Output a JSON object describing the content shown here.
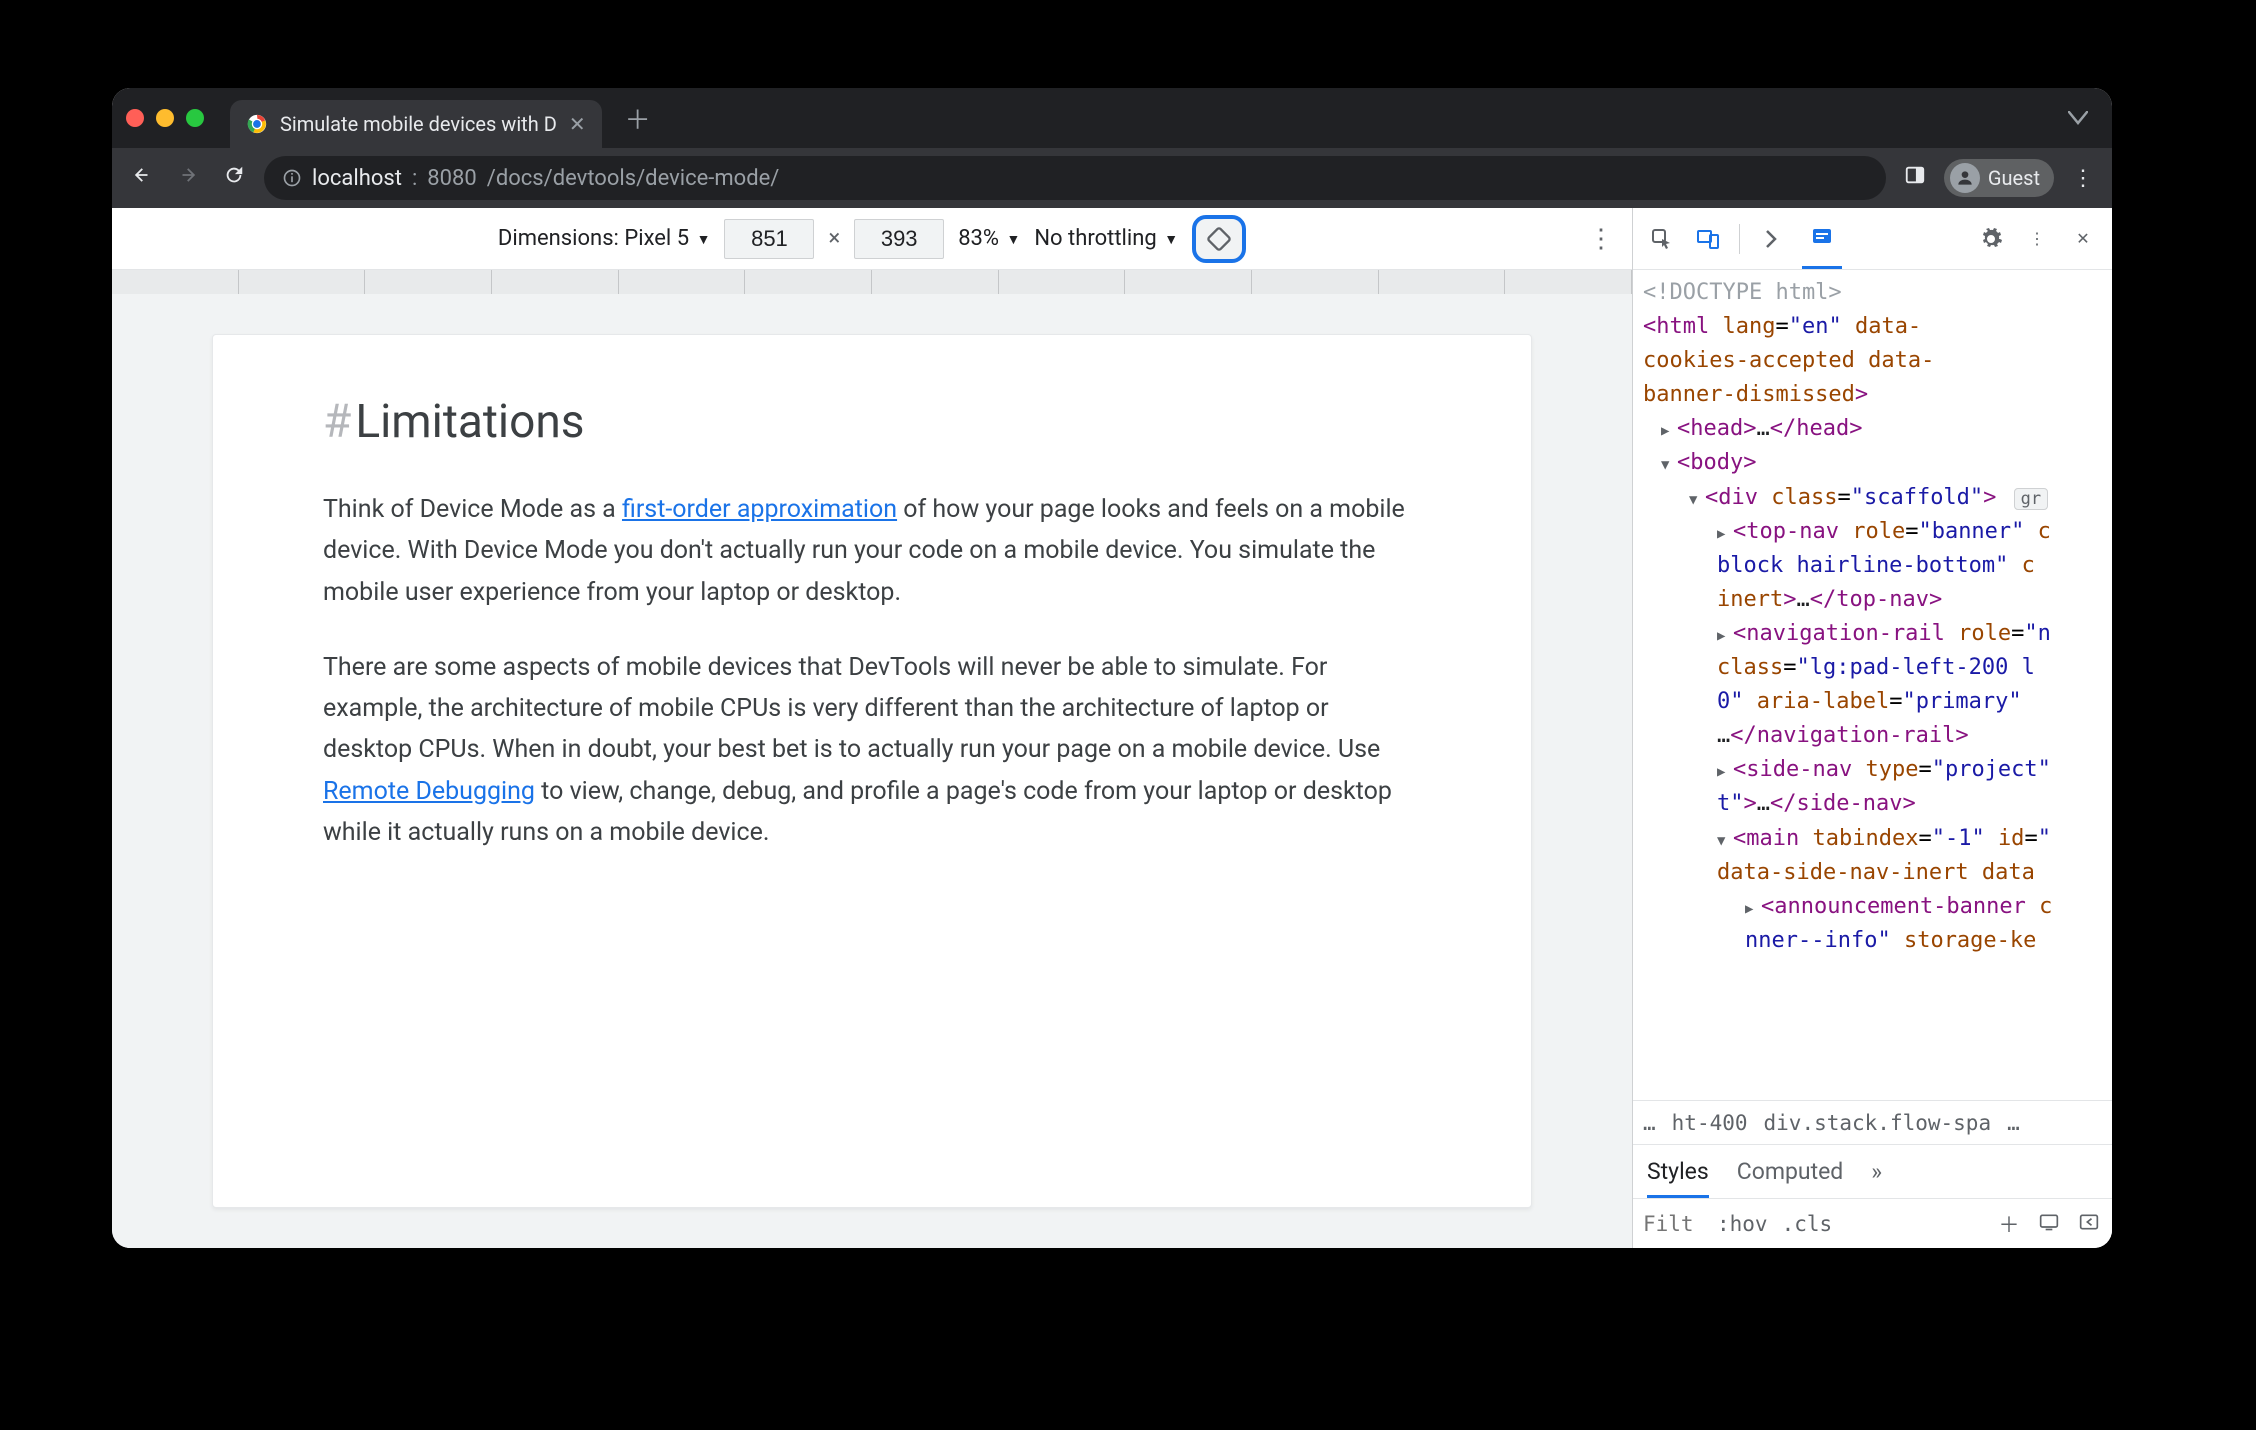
{
  "tab": {
    "title": "Simulate mobile devices with D"
  },
  "url": {
    "host": "localhost",
    "port": "8080",
    "path": "/docs/devtools/device-mode/"
  },
  "profile": {
    "label": "Guest"
  },
  "device_toolbar": {
    "dim_label": "Dimensions: Pixel 5",
    "width": "851",
    "height": "393",
    "zoom": "83%",
    "throttle": "No throttling"
  },
  "page": {
    "heading": "Limitations",
    "hash": "#",
    "p1a": "Think of Device Mode as a ",
    "p1_link": "first-order approximation",
    "p1b": " of how your page looks and feels on a mobile device. With Device Mode you don't actually run your code on a mobile device. You simulate the mobile user experience from your laptop or desktop.",
    "p2a": "There are some aspects of mobile devices that DevTools will never be able to simulate. For example, the architecture of mobile CPUs is very different than the architecture of laptop or desktop CPUs. When in doubt, your best bet is to actually run your page on a mobile device. Use ",
    "p2_link": "Remote Debugging",
    "p2b": " to view, change, debug, and profile a page's code from your laptop or desktop while it actually runs on a mobile device."
  },
  "dom": {
    "doctype": "<!DOCTYPE html>",
    "html_open": "<html lang=\"en\" data-cookies-accepted data-banner-dismissed>",
    "head": "<head>…</head>",
    "body_open": "<body>",
    "div_open": "<div class=\"scaffold\">",
    "scaffold_badge": "gr",
    "topnav": "<top-nav role=\"banner\" c block hairline-bottom\" c inert>…</top-nav>",
    "navrail": "<navigation-rail role=\"n class=\"lg:pad-left-200 l 0\" aria-label=\"primary\" …</navigation-rail>",
    "sidenav": "<side-nav type=\"project\" t\">…</side-nav>",
    "main": "<main tabindex=\"-1\" id=\" data-side-nav-inert data",
    "banner": "<announcement-banner c nner--info\" storage-ke"
  },
  "breadcrumbs": {
    "left": "…",
    "mid": "ht-400",
    "right": "div.stack.flow-spa",
    "end": "…"
  },
  "styles": {
    "tabs": {
      "styles": "Styles",
      "computed": "Computed",
      "more": "»"
    },
    "filter_placeholder": "Filt",
    "hov": ":hov",
    "cls": ".cls"
  }
}
